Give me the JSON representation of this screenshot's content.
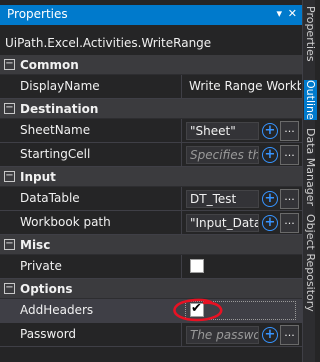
{
  "window": {
    "title": "Properties",
    "pin_glyph": "▾",
    "close_glyph": "✕"
  },
  "activity_type": "UiPath.Excel.Activities.WriteRange",
  "categories": {
    "common": {
      "name": "Common",
      "toggle": "−"
    },
    "destination": {
      "name": "Destination",
      "toggle": "−"
    },
    "input": {
      "name": "Input",
      "toggle": "−"
    },
    "misc": {
      "name": "Misc",
      "toggle": "−"
    },
    "options": {
      "name": "Options",
      "toggle": "−"
    }
  },
  "properties": {
    "display_name": {
      "label": "DisplayName",
      "value": "Write Range Workbook"
    },
    "sheet_name": {
      "label": "SheetName",
      "value": "\"Sheet\""
    },
    "starting_cell": {
      "label": "StartingCell",
      "placeholder": "Specifies the cell"
    },
    "data_table": {
      "label": "DataTable",
      "value": "DT_Test"
    },
    "workbook_path": {
      "label": "Workbook path",
      "value": "\"Input_Data.xlsx\""
    },
    "private": {
      "label": "Private",
      "checked": false
    },
    "add_headers": {
      "label": "AddHeaders",
      "checked": true,
      "check_glyph": "✔"
    },
    "password": {
      "label": "Password",
      "placeholder": "The password"
    }
  },
  "buttons": {
    "plus_glyph": "+",
    "more_glyph": "..."
  },
  "side_tabs": [
    {
      "label": "Properties"
    },
    {
      "label": "Outline"
    },
    {
      "label": "Data Manager"
    },
    {
      "label": "Object Repository"
    }
  ],
  "colors": {
    "accent": "#007acc",
    "annotation": "#e81123"
  }
}
